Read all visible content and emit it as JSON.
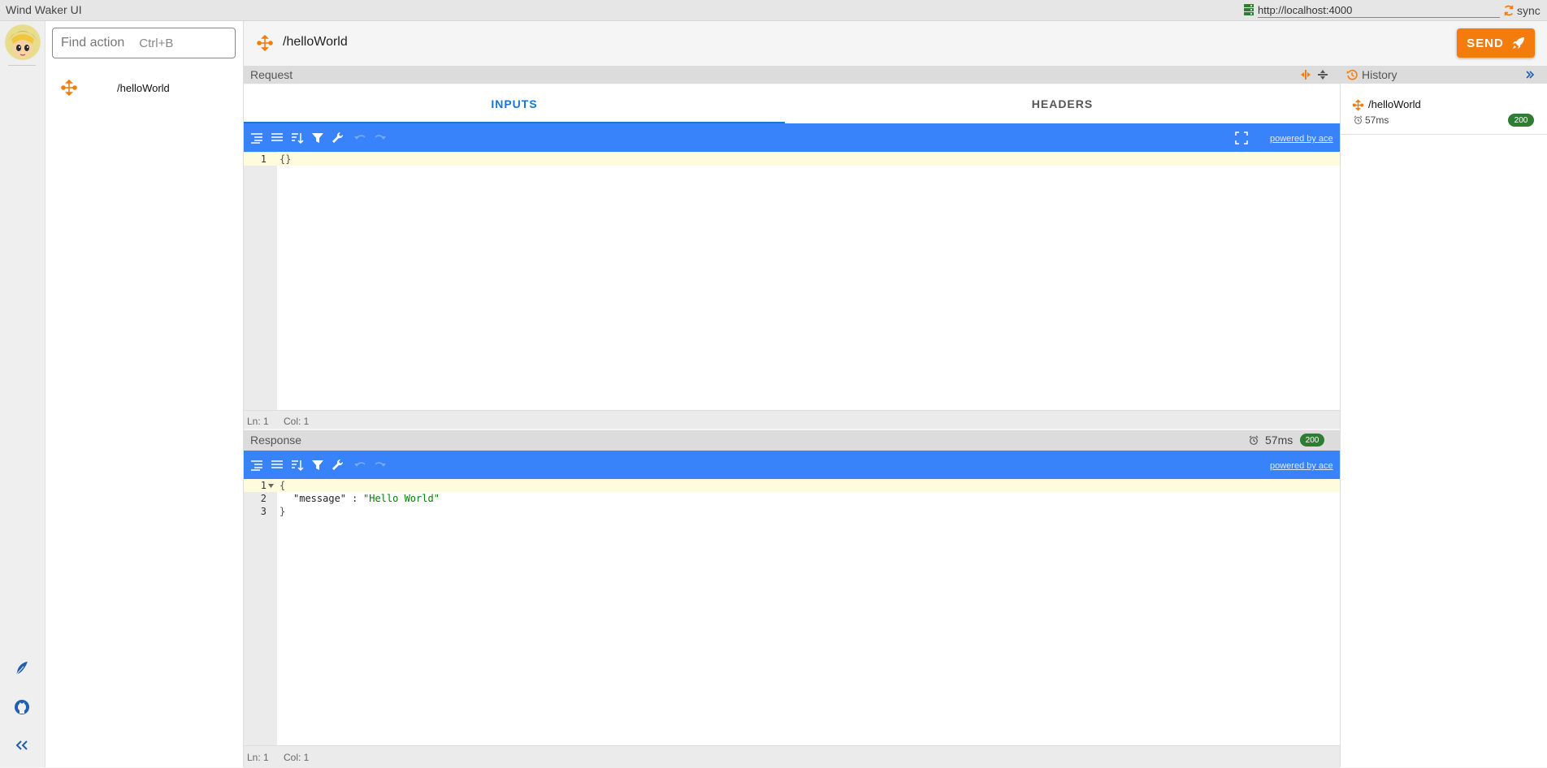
{
  "app": {
    "title": "Wind Waker UI"
  },
  "server": {
    "url": "http://localhost:4000",
    "sync_label": "sync"
  },
  "search": {
    "placeholder": "Find action",
    "shortcut": "Ctrl+B"
  },
  "actions": [
    {
      "label": "/helloWorld",
      "icon": "move-arrows-icon"
    }
  ],
  "header": {
    "title": "/helloWorld",
    "send_label": "SEND"
  },
  "request": {
    "title": "Request",
    "tabs": [
      {
        "label": "INPUTS",
        "active": true
      },
      {
        "label": "HEADERS",
        "active": false
      }
    ],
    "editor": {
      "lines": [
        "1"
      ],
      "code": [
        "{}"
      ],
      "status": {
        "line": "Ln: 1",
        "col": "Col: 1"
      },
      "powered_by": "powered by ace"
    }
  },
  "response": {
    "title": "Response",
    "time": "57ms",
    "status_code": "200",
    "editor": {
      "lines": [
        "1",
        "2",
        "3"
      ],
      "code": [
        "{",
        "\"message\"",
        ": ",
        "\"Hello World\"",
        "}"
      ],
      "status": {
        "line": "Ln: 1",
        "col": "Col: 1"
      },
      "powered_by": "powered by ace"
    }
  },
  "history": {
    "title": "History",
    "items": [
      {
        "label": "/helloWorld",
        "time": "57ms",
        "status_code": "200"
      }
    ]
  },
  "colors": {
    "accent": "#f47c0c",
    "primary": "#1976d2",
    "editor_menu": "#3883fa",
    "success": "#2e7d32"
  }
}
